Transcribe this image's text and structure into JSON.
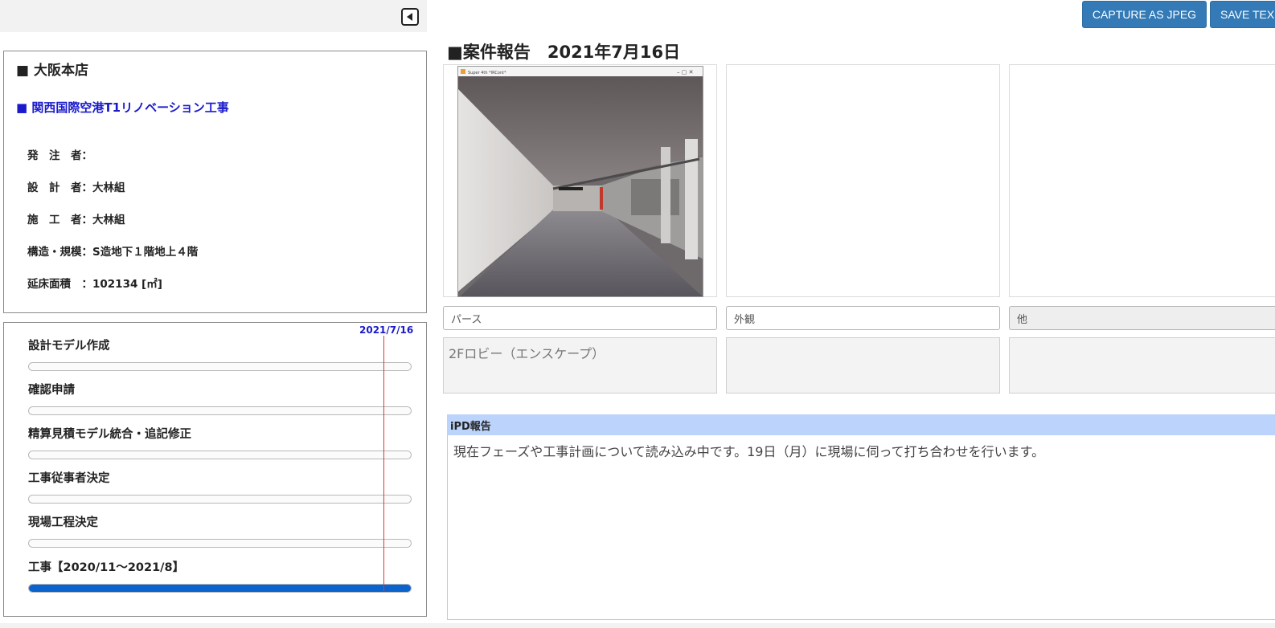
{
  "toolbar": {
    "capture_jpeg_label": "CAPTURE AS JPEG",
    "save_text_label": "SAVE TEX"
  },
  "info": {
    "branch": "■ 大阪本店",
    "project": "■ 関西国際空港T1リノベーション工事",
    "rows": [
      "発　注　者：",
      "設　計　者：大林組",
      "施　工　者：大林組",
      "構造・規模：S造地下１階地上４階",
      "延床面積　：102134 [㎡]"
    ]
  },
  "schedule": {
    "today_label": "2021/7/16",
    "tasks": [
      {
        "label": "設計モデル作成",
        "progress": 0
      },
      {
        "label": "確認申請",
        "progress": 0
      },
      {
        "label": "精算見積モデル統合・追記修正",
        "progress": 0
      },
      {
        "label": "工事従事者決定",
        "progress": 0
      },
      {
        "label": "現場工程決定",
        "progress": 0
      },
      {
        "label": "工事【2020/11～2021/8】",
        "progress": 1.0
      }
    ],
    "progress_color": "#0b63ce"
  },
  "report": {
    "title": "■案件報告　2021年7月16日",
    "photo_window_title": "Super 4th *IRCont*",
    "captions": [
      "パース",
      "外観",
      "他"
    ],
    "descriptions": [
      "2Fロビー（エンスケープ）",
      "",
      ""
    ],
    "ipd_header": "iPD報告",
    "ipd_body": "現在フェーズや工事計画について読み込み中です。19日（月）に現場に伺って打ち合わせを行います。"
  },
  "colors": {
    "accent_button": "#337ab7",
    "project_link": "#1a1acc",
    "today_line": "#d83a3a",
    "ipd_header_bg": "#bcd3fb"
  }
}
